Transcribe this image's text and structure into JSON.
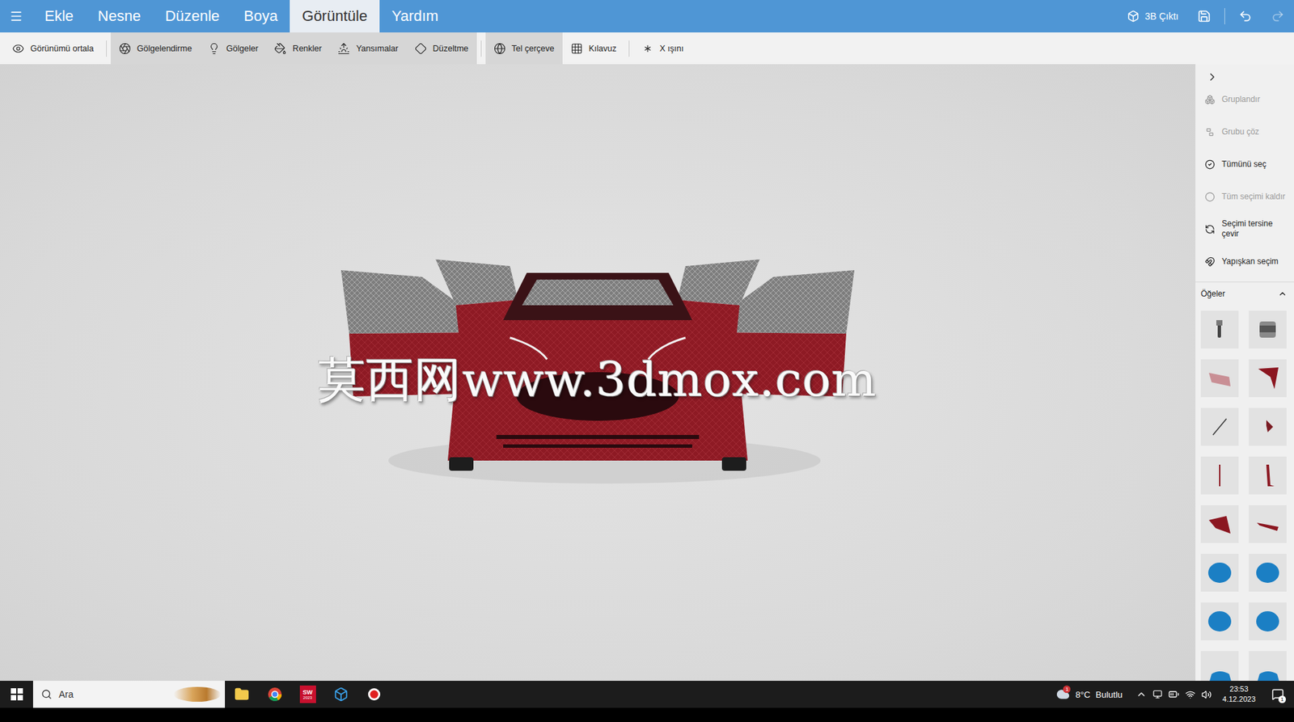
{
  "menu": [
    {
      "label": "Ekle",
      "selected": false
    },
    {
      "label": "Nesne",
      "selected": false
    },
    {
      "label": "Düzenle",
      "selected": false
    },
    {
      "label": "Boya",
      "selected": false
    },
    {
      "label": "Görüntüle",
      "selected": true
    },
    {
      "label": "Yardım",
      "selected": false
    }
  ],
  "menu_actions": {
    "print": "3B Çıktı",
    "undo": {
      "disabled": false
    },
    "redo": {
      "disabled": true
    }
  },
  "toolbar": [
    [
      {
        "label": "Görünümü ortala",
        "on": false
      }
    ],
    [
      {
        "label": "Gölgelendirme",
        "on": true
      },
      {
        "label": "Gölgeler",
        "on": true
      },
      {
        "label": "Renkler",
        "on": true
      },
      {
        "label": "Yansımalar",
        "on": true
      },
      {
        "label": "Düzeltme",
        "on": true
      }
    ],
    [
      {
        "label": "Tel çerçeve",
        "on": true
      },
      {
        "label": "Kılavuz",
        "on": false
      }
    ],
    [
      {
        "label": "X ışını",
        "on": false
      }
    ]
  ],
  "viewport": {
    "watermark": "莫西网www.3dmox.com"
  },
  "side_actions": [
    {
      "label": "Gruplandır",
      "disabled": true
    },
    {
      "label": "Grubu çöz",
      "disabled": true
    },
    {
      "label": "Tümünü seç",
      "disabled": false
    },
    {
      "label": "Tüm seçimi kaldır",
      "disabled": true
    },
    {
      "label": "Seçimi tersine çevir",
      "disabled": false
    },
    {
      "label": "Yapışkan seçim",
      "disabled": false
    }
  ],
  "items_section": {
    "title": "Öğeler",
    "expanded": true,
    "tiles": [
      {
        "kind": "bar"
      },
      {
        "kind": "drum"
      },
      {
        "kind": "panel"
      },
      {
        "kind": "wing"
      },
      {
        "kind": "line"
      },
      {
        "kind": "piece"
      },
      {
        "kind": "rod"
      },
      {
        "kind": "strip"
      },
      {
        "kind": "wedge"
      },
      {
        "kind": "blade"
      },
      {
        "kind": "disc"
      },
      {
        "kind": "disc"
      },
      {
        "kind": "disc"
      },
      {
        "kind": "disc"
      },
      {
        "kind": "edge"
      },
      {
        "kind": "edge"
      }
    ]
  },
  "taskbar": {
    "search_placeholder": "Ara",
    "apps": [
      {
        "kind": "explorer"
      },
      {
        "kind": "chrome"
      },
      {
        "kind": "solidworks",
        "label": "SW",
        "sublabel": "2023"
      },
      {
        "kind": "builder"
      },
      {
        "kind": "recorder"
      }
    ],
    "weather": {
      "temperature": "8°C",
      "condition": "Bulutlu",
      "badge": "1"
    },
    "time": "23:53",
    "date": "4.12.2023",
    "notification_badge": "1"
  }
}
